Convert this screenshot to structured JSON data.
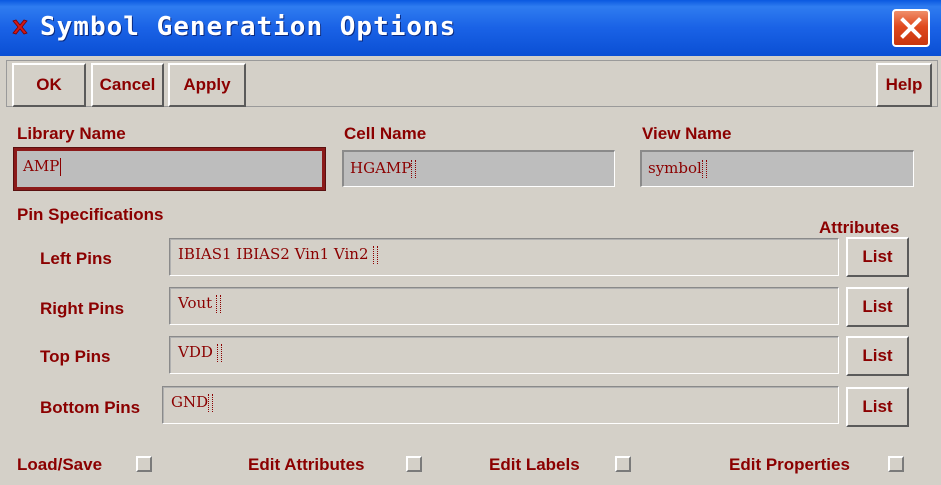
{
  "window": {
    "title": "Symbol Generation Options",
    "icon": "red-x-icon",
    "close_icon": "close-icon"
  },
  "toolbar": {
    "ok_label": "OK",
    "cancel_label": "Cancel",
    "apply_label": "Apply",
    "help_label": "Help"
  },
  "names": {
    "library_label": "Library Name",
    "library_value": "AMP",
    "cell_label": "Cell Name",
    "cell_value": "HGAMP",
    "view_label": "View Name",
    "view_value": "symbol"
  },
  "pins": {
    "section_label": "Pin Specifications",
    "attributes_label": "Attributes",
    "rows": [
      {
        "label": "Left Pins",
        "value": "IBIAS1 IBIAS2 Vin1 Vin2",
        "button": "List"
      },
      {
        "label": "Right Pins",
        "value": "Vout",
        "button": "List"
      },
      {
        "label": "Top Pins",
        "value": "VDD",
        "button": "List"
      },
      {
        "label": "Bottom Pins",
        "value": "GND",
        "button": "List"
      }
    ]
  },
  "options": {
    "load_save": "Load/Save",
    "edit_attributes": "Edit Attributes",
    "edit_labels": "Edit Labels",
    "edit_properties": "Edit Properties"
  },
  "colors": {
    "text": "#8b0000",
    "titlebar": "#1a62e6",
    "background": "#d4d0c8"
  }
}
